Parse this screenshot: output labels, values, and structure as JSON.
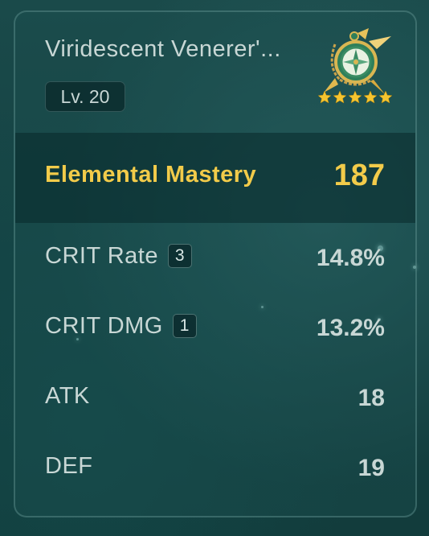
{
  "artifact": {
    "name": "Viridescent Venerer'...",
    "level": "Lv. 20",
    "rarity": 5,
    "icon": "viridescent-artifact-icon"
  },
  "main_stat": {
    "label": "Elemental Mastery",
    "value": "187"
  },
  "substats": [
    {
      "label": "CRIT Rate",
      "rolls": "3",
      "value": "14.8%"
    },
    {
      "label": "CRIT DMG",
      "rolls": "1",
      "value": "13.2%"
    },
    {
      "label": "ATK",
      "rolls": "",
      "value": "18"
    },
    {
      "label": "DEF",
      "rolls": "",
      "value": "19"
    }
  ],
  "colors": {
    "main_stat": "#f2cb4a",
    "text": "#c8d7d5",
    "star": "#f4c430",
    "background": "#144243"
  }
}
